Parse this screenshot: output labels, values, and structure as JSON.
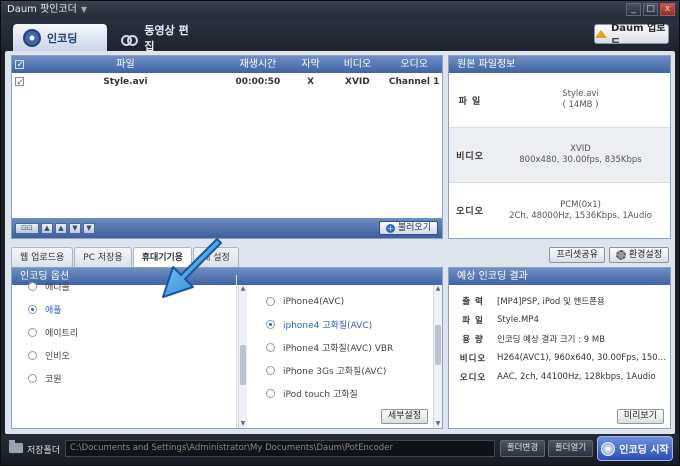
{
  "window": {
    "title": "Daum 팟인코더",
    "min": "_",
    "max": "□",
    "close": "x"
  },
  "topbar": {
    "tabs": [
      {
        "label": "인코딩"
      },
      {
        "label": "동영상 편집"
      }
    ],
    "upload_label": "Daum 업로드"
  },
  "filetable": {
    "headers": [
      "파일",
      "재생시간",
      "자막",
      "비디오",
      "오디오"
    ],
    "rows": [
      {
        "file": "Style.avi",
        "duration": "00:00:50",
        "subtitle": "X",
        "video": "XVID",
        "audio": "Channel 1"
      }
    ],
    "footer_buttons": [
      "⊡⊡",
      "▲",
      "▲",
      "▼",
      "▼"
    ],
    "add_label": "불러오기",
    "add_icon": "+"
  },
  "sourceinfo": {
    "title": "원본 파일정보",
    "rows": [
      {
        "label": "파 일",
        "lines": [
          "Style.avi",
          "( 14MB )"
        ]
      },
      {
        "label": "비디오",
        "lines": [
          "XVID",
          "800x480, 30.00fps, 835Kbps"
        ]
      },
      {
        "label": "오디오",
        "lines": [
          "PCM(0x1)",
          "2Ch, 48000Hz, 1536Kbps, 1Audio"
        ]
      }
    ]
  },
  "subtabs": [
    {
      "label": "웹 업로드용"
    },
    {
      "label": "PC 저장용"
    },
    {
      "label": "휴대기기용"
    },
    {
      "label": "내 설정"
    }
  ],
  "rightbuttons": {
    "preset": "프리셋공유",
    "settings": "환경설정"
  },
  "options": {
    "title": "인코딩 옵션",
    "left_items": [
      {
        "label": "애니콜",
        "selected": false
      },
      {
        "label": "애플",
        "selected": true
      },
      {
        "label": "에이트리",
        "selected": false
      },
      {
        "label": "인비오",
        "selected": false
      },
      {
        "label": "코원",
        "selected": false
      }
    ],
    "right_items": [
      {
        "label": "iPhone4(AVC)",
        "selected": false
      },
      {
        "label": "iphone4 고화질(AVC)",
        "selected": true
      },
      {
        "label": "iPhone4 고화질(AVC) VBR",
        "selected": false
      },
      {
        "label": "iPhone 3Gs 고화질(AVC)",
        "selected": false
      },
      {
        "label": "iPod touch 고화질",
        "selected": false
      }
    ],
    "detail_label": "세부설정"
  },
  "result": {
    "title": "예상 인코딩 결과",
    "rows": [
      {
        "label": "출 력",
        "value": "[MP4]PSP, iPod 및 핸드폰용"
      },
      {
        "label": "파 일",
        "value": "Style.MP4"
      },
      {
        "label": "용 량",
        "value": "인코딩 예상 결과 크기 : 9 MB"
      },
      {
        "label": "비디오",
        "value": "H264(AVC1), 960x640, 30.00Fps, 150..."
      },
      {
        "label": "오디오",
        "value": "AAC, 2ch, 44100Hz, 128kbps, 1Audio"
      }
    ],
    "preview_label": "미리보기"
  },
  "bottombar": {
    "save_label": "저장폴더",
    "path": "C:\\Documents and Settings\\Administrator\\My Documents\\Daum\\PotEncoder",
    "change_label": "폴더변경",
    "open_label": "폴더열기",
    "start_label": "인코딩 시작"
  },
  "colors": {
    "accent": "#2f63c5",
    "header": "#4f70ad",
    "arrow": "#3a9ae0"
  }
}
